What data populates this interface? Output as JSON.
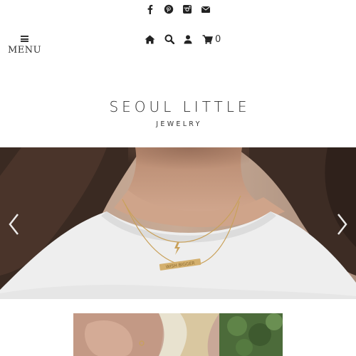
{
  "social": {
    "icons": [
      "facebook-icon",
      "pinterest-icon",
      "instagram-icon",
      "envelope-icon"
    ]
  },
  "nav": {
    "menu_label": "MENU",
    "icons": [
      "home-icon",
      "search-icon",
      "user-icon",
      "shopping-cart-icon"
    ],
    "cart_count": "0"
  },
  "logo": {
    "title": "SEOUL LITTLE",
    "subtitle": "JEWELRY"
  },
  "hero": {
    "necklace_pendant_text": "WISH BIGGER",
    "prev_icon": "chevron-left-icon",
    "next_icon": "chevron-right-icon"
  },
  "colors": {
    "icon": "#222222",
    "text": "#2a2a2a",
    "background": "#ffffff",
    "hair": "#3a2a22",
    "skin": "#c99d84",
    "shirt": "#efefef",
    "gold": "#c9a15a"
  }
}
